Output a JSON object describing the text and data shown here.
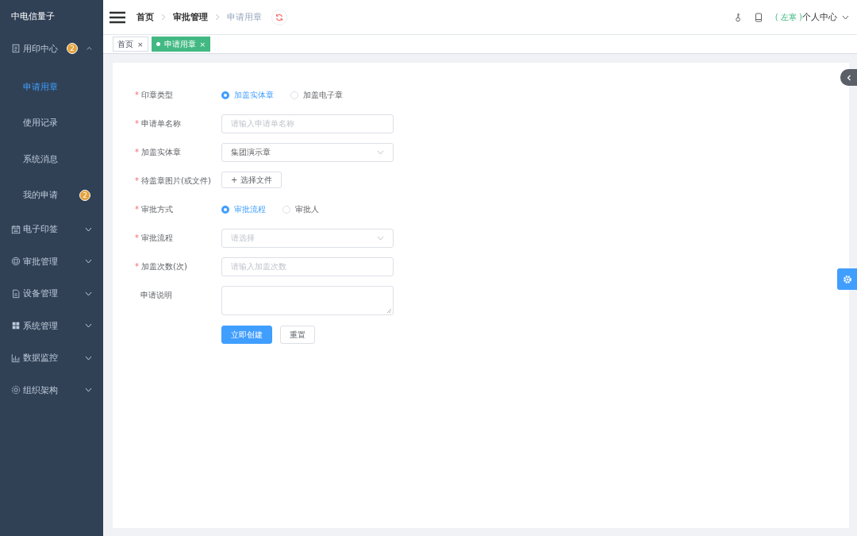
{
  "sidebar": {
    "brand": "中电信量子",
    "items": [
      {
        "label": "用印中心",
        "badge": "2",
        "expanded": true,
        "children": [
          {
            "label": "申请用章",
            "selected": true
          },
          {
            "label": "使用记录",
            "selected": false
          },
          {
            "label": "系统消息",
            "selected": false
          },
          {
            "label": "我的申请",
            "selected": false,
            "badge": "2"
          }
        ]
      },
      {
        "label": "电子印签",
        "expanded": false
      },
      {
        "label": "审批管理",
        "expanded": false
      },
      {
        "label": "设备管理",
        "expanded": false
      },
      {
        "label": "系统管理",
        "expanded": false
      },
      {
        "label": "数据监控",
        "expanded": false
      },
      {
        "label": "组织架构",
        "expanded": false
      }
    ]
  },
  "header": {
    "breadcrumbs": [
      {
        "label": "首页",
        "current": false
      },
      {
        "label": "审批管理",
        "current": false
      },
      {
        "label": "申请用章",
        "current": true
      }
    ],
    "user": {
      "role": "( 左寒 )",
      "label": "个人中心"
    }
  },
  "tags": [
    {
      "label": "首页",
      "selected": false,
      "close": "×"
    },
    {
      "label": "申请用章",
      "selected": true,
      "close": "×"
    }
  ],
  "form": {
    "fields": [
      {
        "kind": "radio",
        "label": "印章类型",
        "required_mark": "*",
        "options": [
          {
            "label": "加盖实体章",
            "selected": true
          },
          {
            "label": "加盖电子章",
            "selected": false
          }
        ]
      },
      {
        "kind": "input",
        "label": "申请单名称",
        "required_mark": "*",
        "placeholder": "请输入申请单名称"
      },
      {
        "kind": "select",
        "label": "加盖实体章",
        "required_mark": "*",
        "value": "集团演示章"
      },
      {
        "kind": "upload",
        "label": "待盖章图片(或文件)",
        "required_mark": "*",
        "button": "+ 选择文件"
      },
      {
        "kind": "radio",
        "label": "审批方式",
        "required_mark": "*",
        "options": [
          {
            "label": "审批流程",
            "selected": true
          },
          {
            "label": "审批人",
            "selected": false
          }
        ]
      },
      {
        "kind": "select",
        "label": "审批流程",
        "required_mark": "*",
        "placeholder": "请选择"
      },
      {
        "kind": "input",
        "label": "加盖次数(次)",
        "required_mark": "*",
        "placeholder": "请输入加盖次数"
      },
      {
        "kind": "textarea",
        "label": "申请说明"
      }
    ],
    "buttons": [
      {
        "label": "立即创建",
        "kind": "primary"
      },
      {
        "label": "重置",
        "kind": "default"
      }
    ]
  }
}
